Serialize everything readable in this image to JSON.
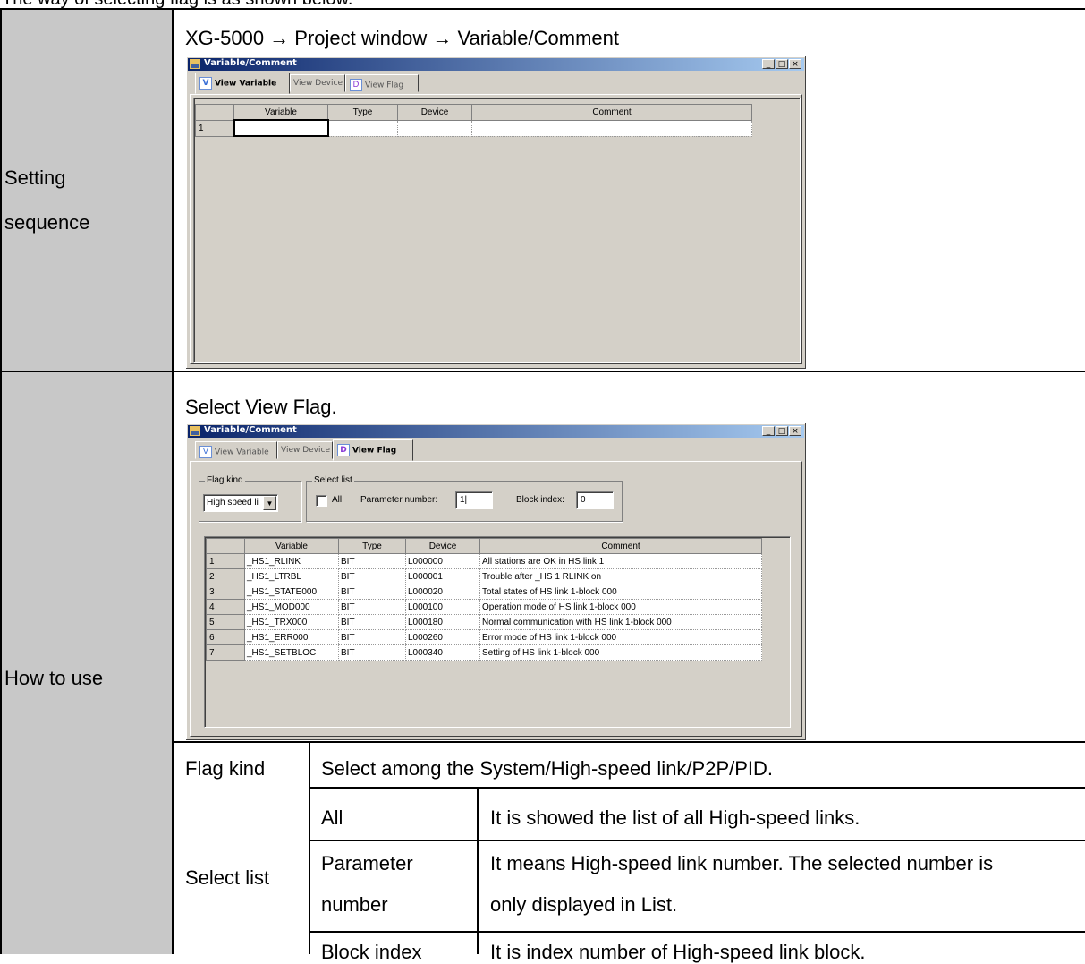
{
  "intro": "The way of selecting flag is as shown below.",
  "rows": {
    "setting": {
      "label_line1": "Setting",
      "label_line2": "sequence",
      "caption": "XG-5000   → Project window   → Variable/Comment"
    },
    "howto": {
      "label": "How to use",
      "caption": "Select View Flag."
    }
  },
  "window": {
    "title": "Variable/Comment",
    "buttons": {
      "minimize": "_",
      "maximize": "□",
      "close": "×"
    },
    "tabs": {
      "view_variable": "View Variable",
      "view_device": "View Device",
      "view_flag": "View Flag",
      "v_icon": "V",
      "d_icon": "D"
    }
  },
  "grid1": {
    "headers": [
      "Variable",
      "Type",
      "Device",
      "Comment"
    ],
    "row_numbers": [
      "1"
    ]
  },
  "flag_panel": {
    "flag_kind_label": "Flag kind",
    "flag_kind_value": "High speed li",
    "select_list_label": "Select list",
    "all_label": "All",
    "parameter_number_label": "Parameter number:",
    "parameter_number_value": "1|",
    "block_index_label": "Block index:",
    "block_index_value": "0"
  },
  "grid2": {
    "headers": [
      "Variable",
      "Type",
      "Device",
      "Comment"
    ],
    "rows": [
      {
        "n": "1",
        "variable": "_HS1_RLINK",
        "type": "BIT",
        "device": "L000000",
        "comment": "All stations are OK in HS link 1"
      },
      {
        "n": "2",
        "variable": "_HS1_LTRBL",
        "type": "BIT",
        "device": "L000001",
        "comment": "Trouble after _HS 1 RLINK on"
      },
      {
        "n": "3",
        "variable": "_HS1_STATE000",
        "type": "BIT",
        "device": "L000020",
        "comment": "Total states of HS link 1-block 000"
      },
      {
        "n": "4",
        "variable": "_HS1_MOD000",
        "type": "BIT",
        "device": "L000100",
        "comment": "Operation mode of HS link 1-block 000"
      },
      {
        "n": "5",
        "variable": "_HS1_TRX000",
        "type": "BIT",
        "device": "L000180",
        "comment": "Normal communication with HS link 1-block 000"
      },
      {
        "n": "6",
        "variable": "_HS1_ERR000",
        "type": "BIT",
        "device": "L000260",
        "comment": "Error mode of HS link 1-block 000"
      },
      {
        "n": "7",
        "variable": "_HS1_SETBLOC",
        "type": "BIT",
        "device": "L000340",
        "comment": "Setting of HS link 1-block 000"
      }
    ]
  },
  "desc": {
    "flag_kind": {
      "term": "Flag kind",
      "text": "Select among the System/High-speed link/P2P/PID."
    },
    "select_list": {
      "term": "Select list"
    },
    "all": {
      "term": "All",
      "text": "It is showed the list of all High-speed links."
    },
    "param": {
      "term1": "Parameter",
      "term2": "number",
      "text1": "It means High-speed link number. The selected number is",
      "text2": "only displayed in List."
    },
    "block": {
      "term": "Block index",
      "text": "It is index number of High-speed link block."
    }
  }
}
